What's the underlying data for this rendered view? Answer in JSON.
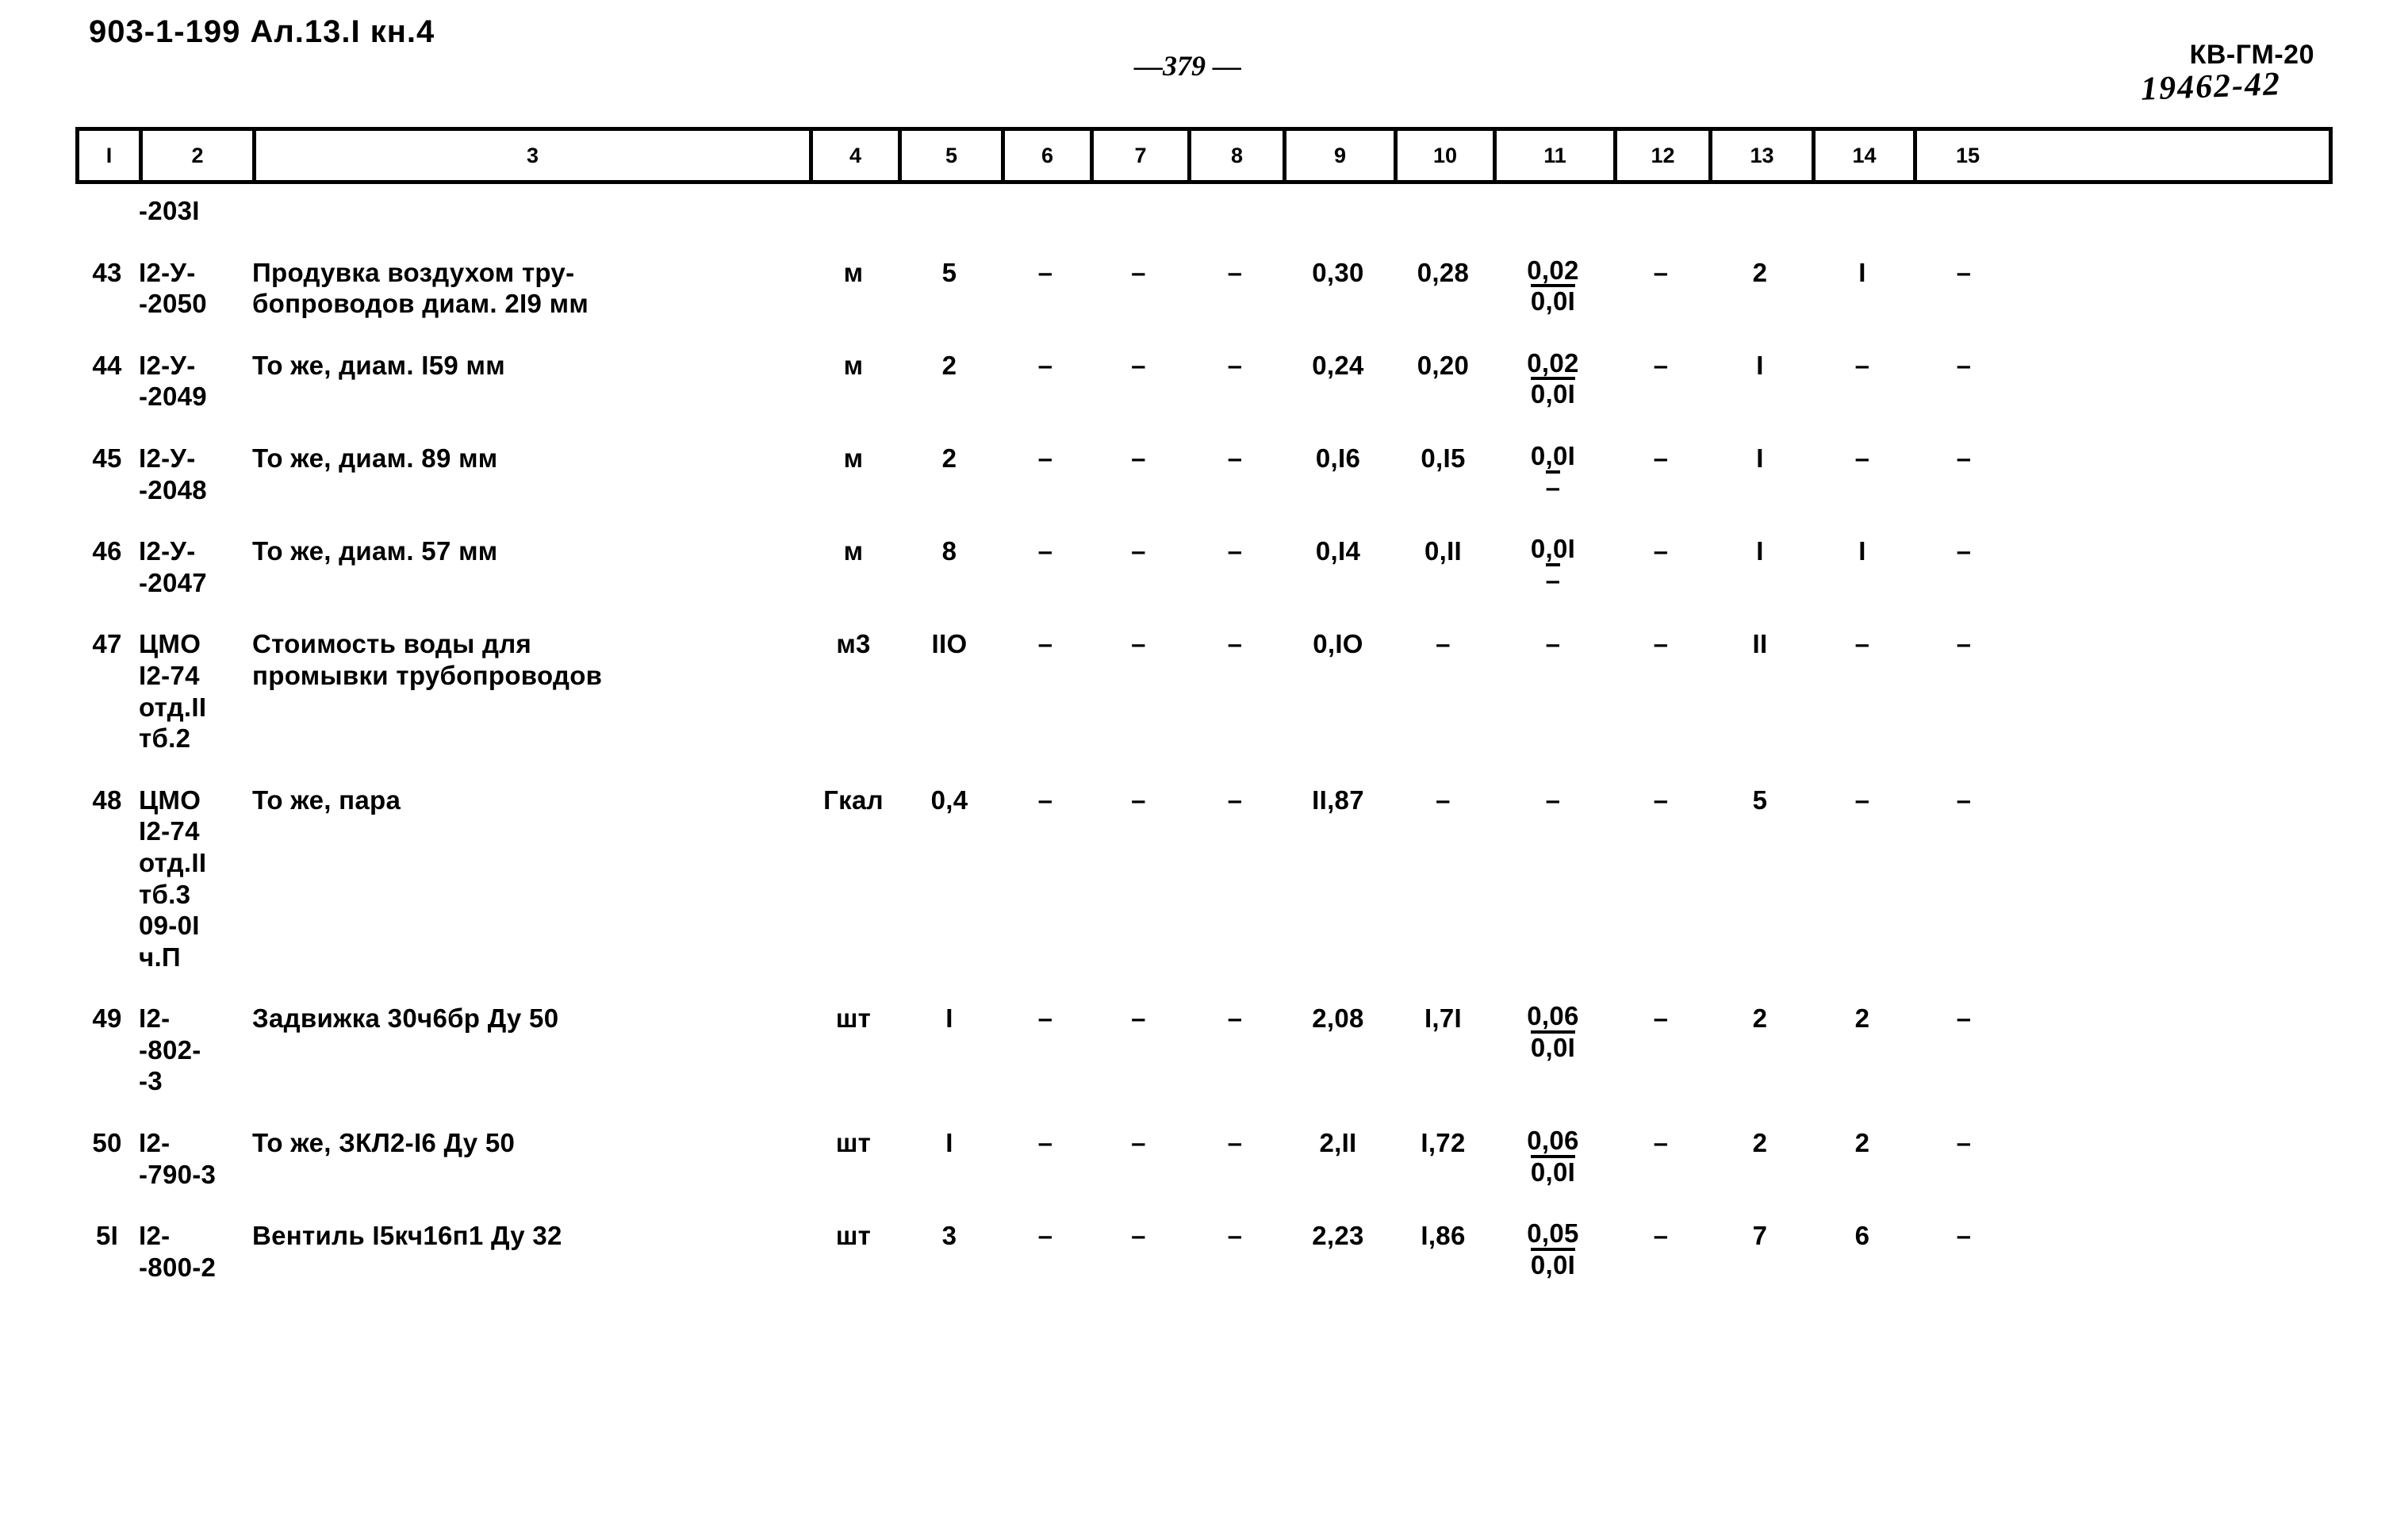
{
  "header": {
    "doc_code": "903-1-199 Ал.13.I кн.4",
    "page_number": "—379 —",
    "sheet_code": "КВ-ГМ-20",
    "hand_written_code": "19462-42"
  },
  "table": {
    "column_numbers": [
      "I",
      "2",
      "3",
      "4",
      "5",
      "6",
      "7",
      "8",
      "9",
      "10",
      "11",
      "12",
      "13",
      "14",
      "15"
    ],
    "continuation_cell": "-203I",
    "rows": [
      {
        "num": "43",
        "code": "I2-У-\n-2050",
        "name": "Продувка воздухом тру-\nбопроводов диам. 2I9 мм",
        "unit": "м",
        "qty": "5",
        "c6": "–",
        "c7": "–",
        "c8": "–",
        "c9": "0,30",
        "c10": "0,28",
        "c11_num": "0,02",
        "c11_den": "0,0I",
        "c12": "–",
        "c13": "2",
        "c14": "I",
        "c15": "–"
      },
      {
        "num": "44",
        "code": "I2-У-\n-2049",
        "name": "То же, диам. I59 мм",
        "unit": "м",
        "qty": "2",
        "c6": "–",
        "c7": "–",
        "c8": "–",
        "c9": "0,24",
        "c10": "0,20",
        "c11_num": "0,02",
        "c11_den": "0,0I",
        "c12": "–",
        "c13": "I",
        "c14": "–",
        "c15": "–"
      },
      {
        "num": "45",
        "code": "I2-У-\n-2048",
        "name": "То же, диам. 89 мм",
        "unit": "м",
        "qty": "2",
        "c6": "–",
        "c7": "–",
        "c8": "–",
        "c9": "0,I6",
        "c10": "0,I5",
        "c11_num": "0,0I",
        "c11_den": "–",
        "c12": "–",
        "c13": "I",
        "c14": "–",
        "c15": "–"
      },
      {
        "num": "46",
        "code": "I2-У-\n-2047",
        "name": "То же, диам. 57 мм",
        "unit": "м",
        "qty": "8",
        "c6": "–",
        "c7": "–",
        "c8": "–",
        "c9": "0,I4",
        "c10": "0,II",
        "c11_num": "0,0I",
        "c11_den": "–",
        "c12": "–",
        "c13": "I",
        "c14": "I",
        "c15": "–"
      },
      {
        "num": "47",
        "code": "ЦМО\nI2-74\nотд.II\nтб.2",
        "name": "Стоимость воды для\nпромывки трубопроводов",
        "unit": "м3",
        "qty": "IIO",
        "c6": "–",
        "c7": "–",
        "c8": "–",
        "c9": "0,IO",
        "c10": "–",
        "c11_num": "–",
        "c11_den": "",
        "c12": "–",
        "c13": "II",
        "c14": "–",
        "c15": "–"
      },
      {
        "num": "48",
        "code": "ЦМО\nI2-74\nотд.II\nтб.3\n09-0I\nч.П",
        "name": "То же, пара",
        "unit": "Гкал",
        "qty": "0,4",
        "c6": "–",
        "c7": "–",
        "c8": "–",
        "c9": "II,87",
        "c10": "–",
        "c11_num": "–",
        "c11_den": "",
        "c12": "–",
        "c13": "5",
        "c14": "–",
        "c15": "–"
      },
      {
        "num": "49",
        "code": "I2-\n-802-\n-3",
        "name": "Задвижка 30ч6бр Ду 50",
        "unit": "шт",
        "qty": "I",
        "c6": "–",
        "c7": "–",
        "c8": "–",
        "c9": "2,08",
        "c10": "I,7I",
        "c11_num": "0,06",
        "c11_den": "0,0I",
        "c12": "–",
        "c13": "2",
        "c14": "2",
        "c15": "–"
      },
      {
        "num": "50",
        "code": "I2-\n-790-3",
        "name": "То же, ЗКЛ2-I6 Ду 50",
        "unit": "шт",
        "qty": "I",
        "c6": "–",
        "c7": "–",
        "c8": "–",
        "c9": "2,II",
        "c10": "I,72",
        "c11_num": "0,06",
        "c11_den": "0,0I",
        "c12": "–",
        "c13": "2",
        "c14": "2",
        "c15": "–"
      },
      {
        "num": "5I",
        "code": "I2-\n-800-2",
        "name": "Вентиль I5кч16п1 Ду 32",
        "unit": "шт",
        "qty": "3",
        "c6": "–",
        "c7": "–",
        "c8": "–",
        "c9": "2,23",
        "c10": "I,86",
        "c11_num": "0,05",
        "c11_den": "0,0I",
        "c12": "–",
        "c13": "7",
        "c14": "6",
        "c15": "–"
      }
    ]
  }
}
